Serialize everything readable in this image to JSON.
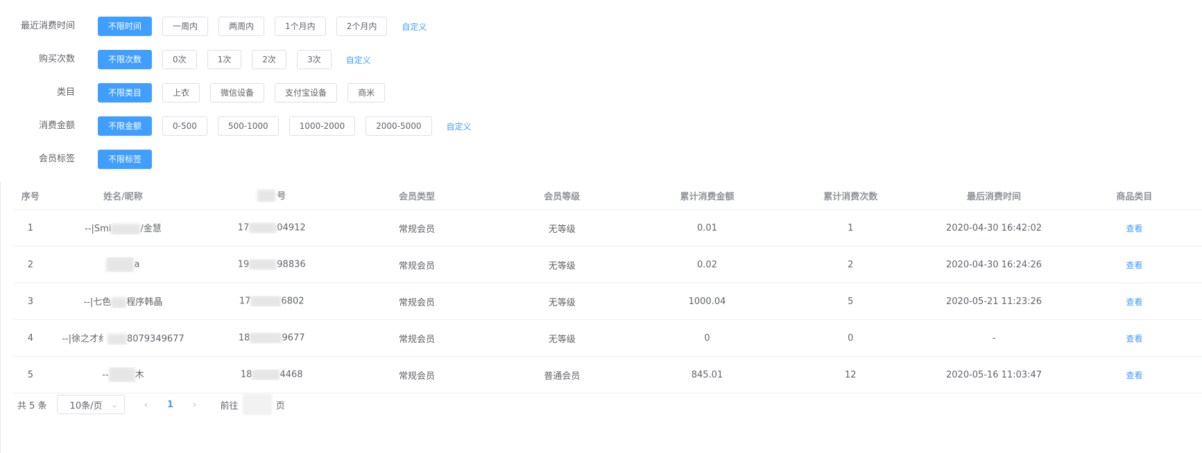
{
  "filters": [
    {
      "label": "最近消费时间",
      "options": [
        "不限时间",
        "一周内",
        "两周内",
        "1个月内",
        "2个月内"
      ],
      "custom": "自定义"
    },
    {
      "label": "购买次数",
      "options": [
        "不限次数",
        "0次",
        "1次",
        "2次",
        "3次"
      ],
      "custom": "自定义"
    },
    {
      "label": "类目",
      "options": [
        "不限类目",
        "上衣",
        "微信设备",
        "支付宝设备",
        "商米"
      ],
      "custom": ""
    },
    {
      "label": "消费金额",
      "options": [
        "不限金额",
        "0-500",
        "500-1000",
        "1000-2000",
        "2000-5000"
      ],
      "custom": "自定义"
    },
    {
      "label": "会员标签",
      "options": [
        "不限标签"
      ],
      "custom": ""
    }
  ],
  "table": {
    "headers": [
      "序号",
      "姓名/昵称",
      "号",
      "会员类型",
      "会员等级",
      "累计消费金额",
      "累计消费次数",
      "最后消费时间",
      "商品类目"
    ],
    "rows": [
      {
        "idx": "1",
        "name_a": "--|Smi",
        "name_b": "/金慧",
        "phone_a": "17",
        "phone_b": "04912",
        "type": "常规会员",
        "level": "无等级",
        "amount": "0.01",
        "count": "1",
        "last": "2020-04-30 16:42:02",
        "action": "查看"
      },
      {
        "idx": "2",
        "name_a": "",
        "name_b": "a",
        "phone_a": "19",
        "phone_b": "98836",
        "type": "常规会员",
        "level": "无等级",
        "amount": "0.02",
        "count": "2",
        "last": "2020-04-30 16:24:26",
        "action": "查看"
      },
      {
        "idx": "3",
        "name_a": "--|七色",
        "name_b": "程序韩晶",
        "phone_a": "17",
        "phone_b": "6802",
        "type": "常规会员",
        "level": "无等级",
        "amount": "1000.04",
        "count": "5",
        "last": "2020-05-21 11:23:26",
        "action": "查看"
      },
      {
        "idx": "4",
        "name_a": "--|徐之才纟",
        "name_b": "8079349677",
        "phone_a": "18",
        "phone_b": "9677",
        "type": "常规会员",
        "level": "无等级",
        "amount": "0",
        "count": "0",
        "last": "-",
        "action": "查看"
      },
      {
        "idx": "5",
        "name_a": "--",
        "name_b": "木",
        "phone_a": "18",
        "phone_b": "4468",
        "type": "常规会员",
        "level": "普通会员",
        "amount": "845.01",
        "count": "12",
        "last": "2020-05-16 11:03:47",
        "action": "查看"
      }
    ]
  },
  "pager": {
    "total": "共 5 条",
    "page_size": "10条/页",
    "current": "1",
    "goto_prefix": "前往",
    "goto_suffix": "页",
    "prev": "‹",
    "next": "›",
    "dropdown": "⌄"
  },
  "colors": {
    "primary": "#409eff",
    "border": "#dcdfe6",
    "text": "#606266"
  }
}
